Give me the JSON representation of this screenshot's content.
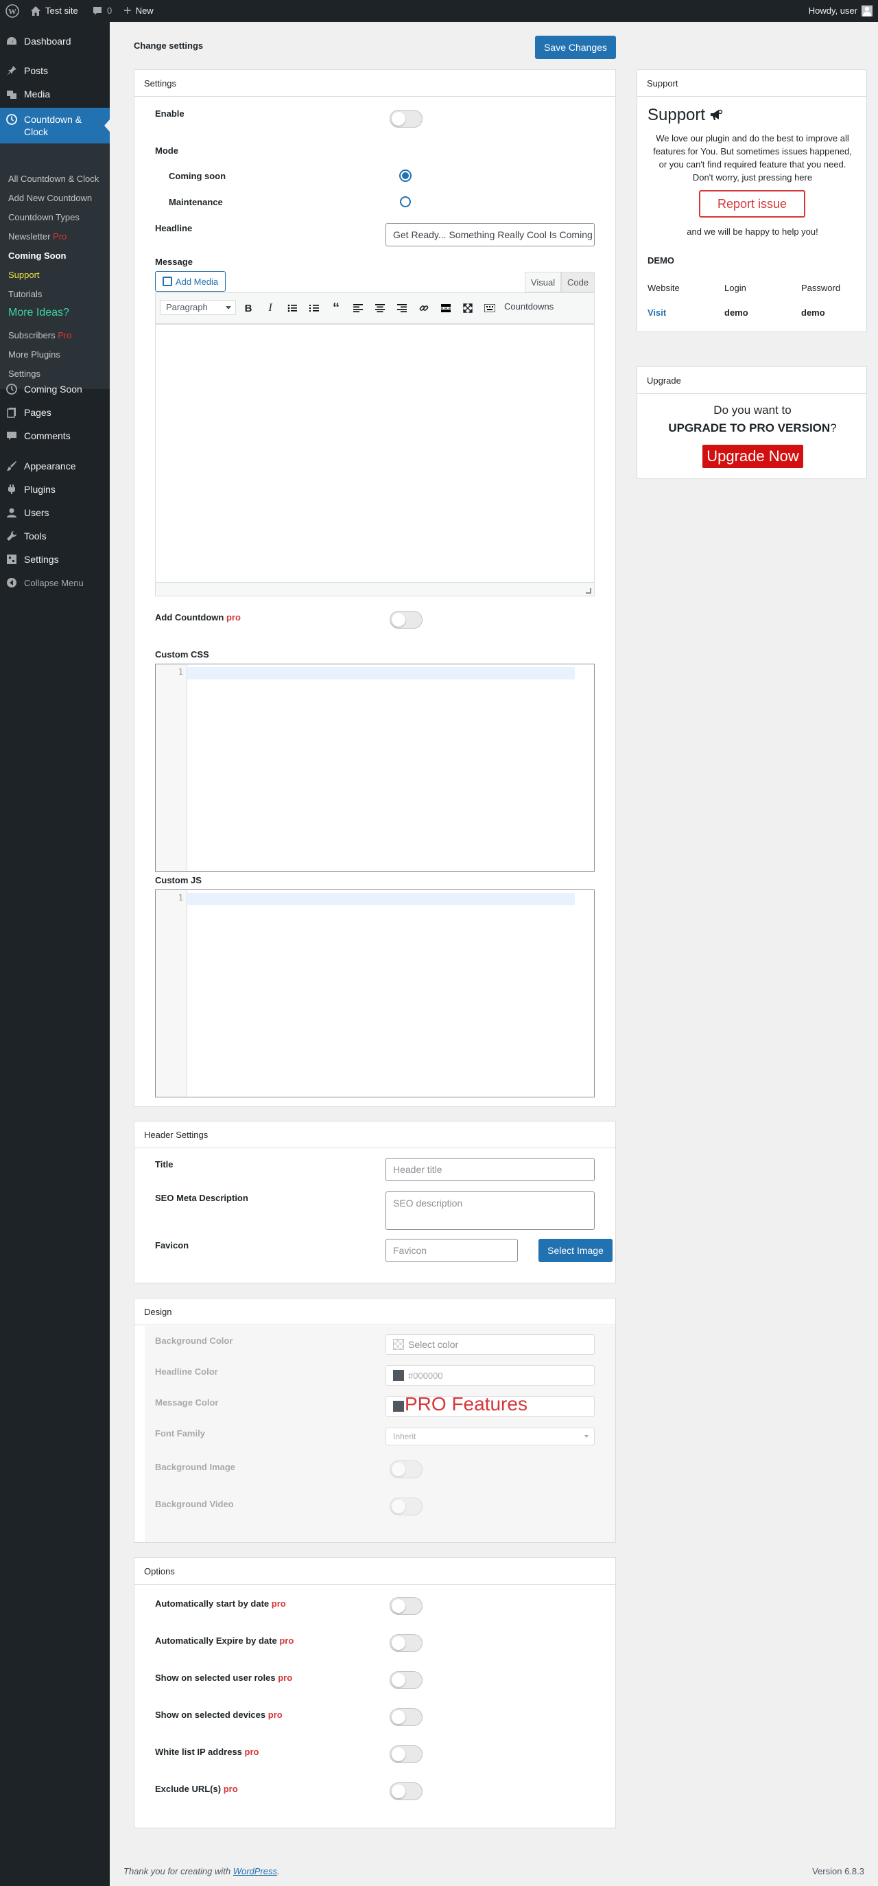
{
  "adminbar": {
    "site": "Test site",
    "comments": "0",
    "new": "New",
    "howdy": "Howdy, user"
  },
  "menu": {
    "dashboard": "Dashboard",
    "posts": "Posts",
    "media": "Media",
    "countdown": "Countdown & Clock",
    "sub": [
      "All Countdown & Clock",
      "Add New Countdown",
      "Countdown Types",
      "Newsletter",
      "Coming Soon",
      "Support",
      "Tutorials",
      "More Ideas?",
      "Subscribers",
      "More Plugins",
      "Settings"
    ],
    "pro_tag": "Pro",
    "coming_soon": "Coming Soon",
    "pages": "Pages",
    "comments": "Comments",
    "appearance": "Appearance",
    "plugins": "Plugins",
    "users": "Users",
    "tools": "Tools",
    "settings": "Settings",
    "collapse": "Collapse Menu"
  },
  "page": {
    "title": "Change settings",
    "save": "Save Changes"
  },
  "settings": {
    "header": "Settings",
    "enable": "Enable",
    "mode": "Mode",
    "coming_soon": "Coming soon",
    "maintenance": "Maintenance",
    "headline": "Headline",
    "headline_value": "Get Ready... Something Really Cool Is Coming Soon",
    "message": "Message",
    "add_media": "Add Media",
    "visual": "Visual",
    "code": "Code",
    "paragraph": "Paragraph",
    "countdowns": "Countdowns",
    "add_countdown": "Add Countdown",
    "pro": "pro",
    "custom_css": "Custom CSS",
    "custom_js": "Custom JS",
    "line": "1"
  },
  "header_settings": {
    "header": "Header Settings",
    "title": "Title",
    "title_ph": "Header title",
    "seo": "SEO Meta Description",
    "seo_ph": "SEO description",
    "favicon": "Favicon",
    "favicon_ph": "Favicon",
    "select_image": "Select Image"
  },
  "design": {
    "header": "Design",
    "bg_color": "Background Color",
    "bg_color_ph": "Select color",
    "headline_color": "Headline Color",
    "headline_color_val": "#000000",
    "message_color": "Message Color",
    "font_family": "Font Family",
    "font_val": "Inherit",
    "bg_image": "Background Image",
    "bg_video": "Background Video",
    "pro_features": "PRO Features"
  },
  "options": {
    "header": "Options",
    "items": [
      "Automatically start by date",
      "Automatically Expire by date",
      "Show on selected user roles",
      "Show on selected devices",
      "White list IP address",
      "Exclude URL(s)"
    ],
    "pro": "pro"
  },
  "support": {
    "header": "Support",
    "title": "Support",
    "text1": "We love our plugin and do the best to improve all",
    "text2": "features for You. But sometimes issues happened,",
    "text3": "or you can't find required feature that you need.",
    "text4": "Don't worry, just pressing here",
    "report": "Report issue",
    "help": "and we will be happy to help you!",
    "demo": "DEMO",
    "website": "Website",
    "login": "Login",
    "password": "Password",
    "visit": "Visit",
    "demo_login": "demo",
    "demo_pass": "demo"
  },
  "upgrade": {
    "header": "Upgrade",
    "line1": "Do you want to",
    "line2": "UPGRADE TO PRO VERSION",
    "q": "?",
    "button": "Upgrade Now"
  },
  "footer": {
    "thanks": "Thank you for creating with",
    "wp": "WordPress",
    "dot": ".",
    "version": "Version 6.8.3"
  },
  "colors": {
    "accent": "#2271b1",
    "pro": "#d63638",
    "sidebar": "#1d2327"
  }
}
